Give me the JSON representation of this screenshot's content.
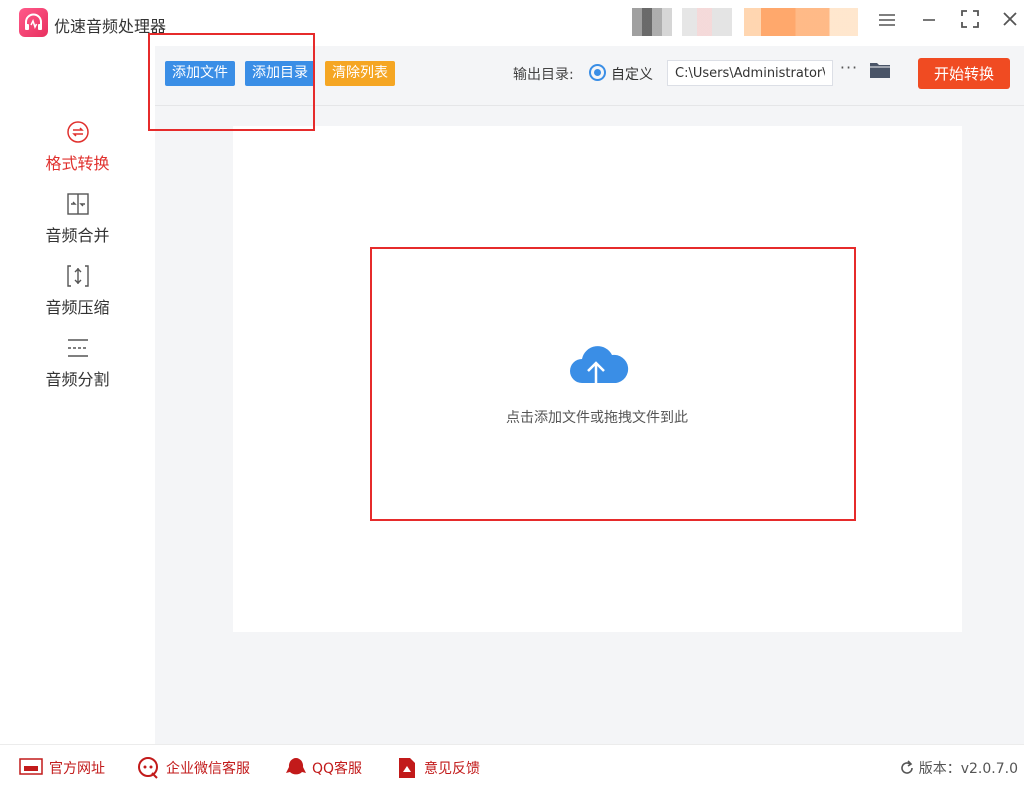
{
  "app": {
    "title": "优速音频处理器"
  },
  "sidebar": {
    "items": [
      {
        "label": "格式转换",
        "active": true,
        "icon": "format-convert-icon"
      },
      {
        "label": "音频合并",
        "active": false,
        "icon": "audio-merge-icon"
      },
      {
        "label": "音频压缩",
        "active": false,
        "icon": "audio-compress-icon"
      },
      {
        "label": "音频分割",
        "active": false,
        "icon": "audio-split-icon"
      }
    ]
  },
  "toolbar": {
    "add_file": "添加文件",
    "add_dir": "添加目录",
    "clear_list": "清除列表",
    "output_label": "输出目录:",
    "radio_custom": "自定义",
    "output_path": "C:\\Users\\Administrator\\",
    "more": "···",
    "start": "开始转换"
  },
  "dropzone": {
    "text": "点击添加文件或拖拽文件到此"
  },
  "footer": {
    "website": "官方网址",
    "wechat": "企业微信客服",
    "qq": "QQ客服",
    "feedback": "意见反馈",
    "version": "版本：v2.0.7.0"
  },
  "colors": {
    "accent_blue": "#3a8ee6",
    "accent_orange": "#f5a623",
    "start_red": "#f04b22",
    "active_red": "#e0312e",
    "highlight_red": "#e62b2b"
  }
}
